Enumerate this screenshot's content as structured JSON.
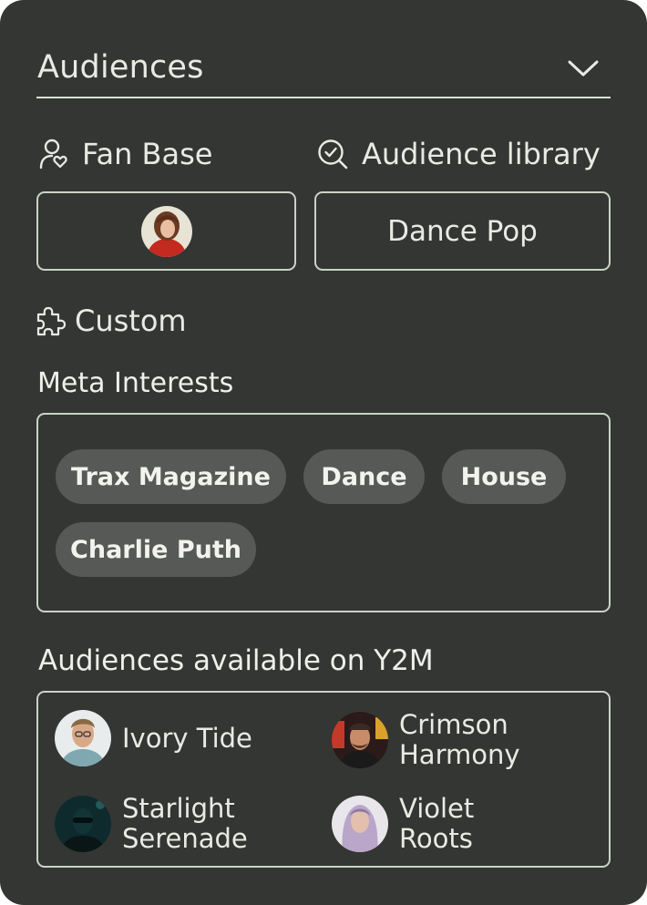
{
  "header": {
    "title": "Audiences",
    "toggle_icon": "chevron-down-icon"
  },
  "sources": {
    "fan_base": {
      "label": "Fan Base",
      "icon": "user-heart-icon"
    },
    "audience_library": {
      "label": "Audience library",
      "icon": "search-check-icon",
      "selected_value": "Dance Pop"
    }
  },
  "custom": {
    "label": "Custom",
    "icon": "puzzle-icon"
  },
  "meta_interests": {
    "heading": "Meta Interests",
    "chips": [
      "Trax Magazine",
      "Dance",
      "House",
      "Charlie Puth"
    ]
  },
  "available": {
    "heading": "Audiences available on Y2M",
    "items": [
      {
        "name": "Ivory Tide"
      },
      {
        "name": "Crimson Harmony"
      },
      {
        "name": "Starlight Serenade"
      },
      {
        "name": "Violet Roots"
      }
    ]
  },
  "colors": {
    "panel_background": "#343633",
    "border": "#c9d3c6",
    "chip_background": "#575956",
    "text": "#e8ebe3"
  }
}
